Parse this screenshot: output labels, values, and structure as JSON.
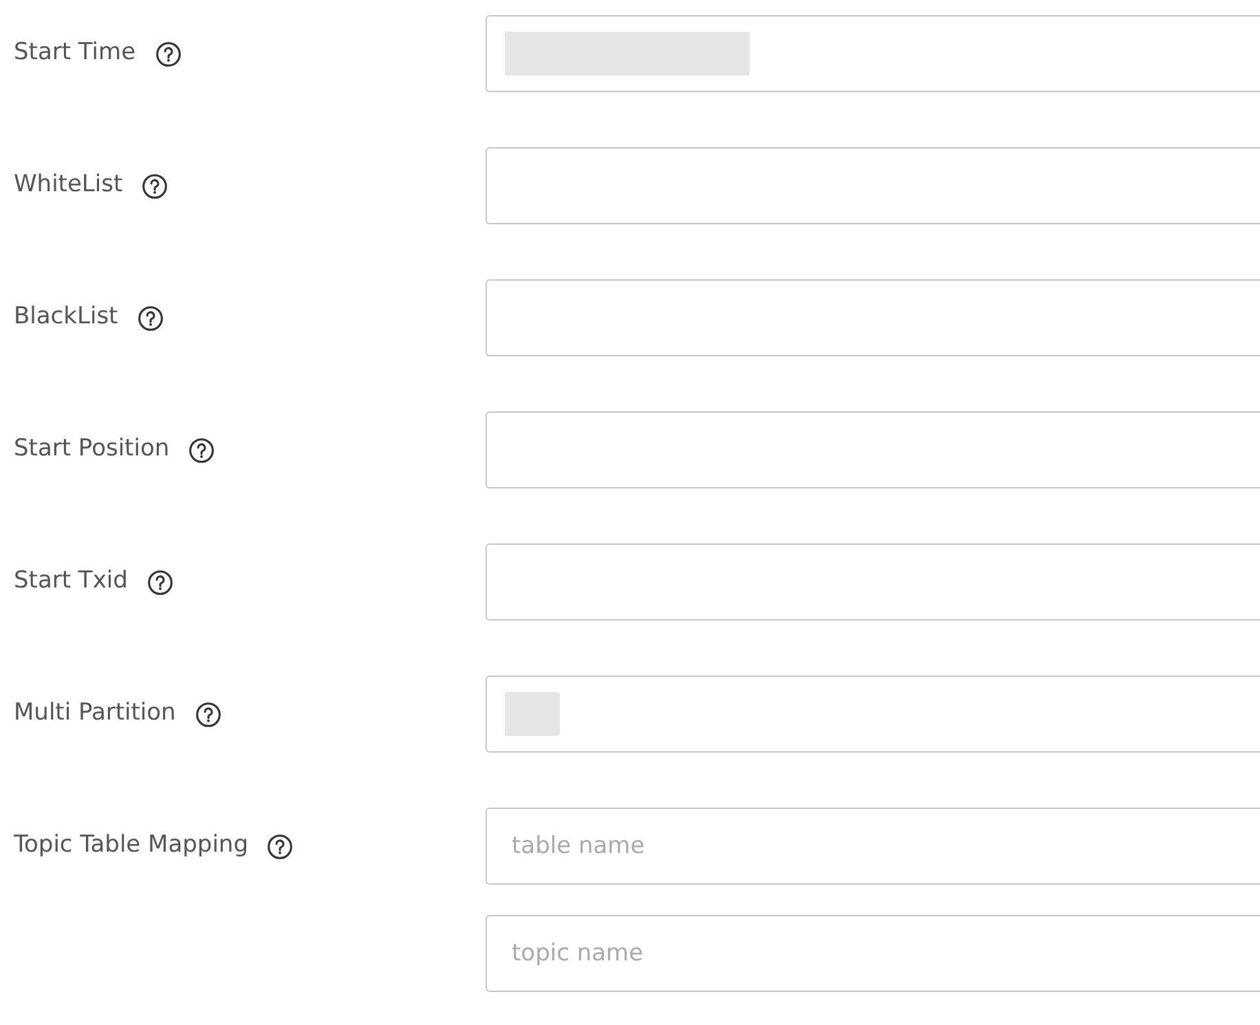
{
  "fields": [
    {
      "label": "Start Time",
      "redacted": true,
      "wide": true
    },
    {
      "label": "WhiteList"
    },
    {
      "label": "BlackList"
    },
    {
      "label": "Start Position"
    },
    {
      "label": "Start Txid"
    },
    {
      "label": "Multi Partition",
      "redacted": true,
      "wide": false
    },
    {
      "label": "Topic Table Mapping",
      "inputs": [
        {
          "placeholder": "table name"
        },
        {
          "placeholder": "topic name"
        }
      ]
    }
  ]
}
